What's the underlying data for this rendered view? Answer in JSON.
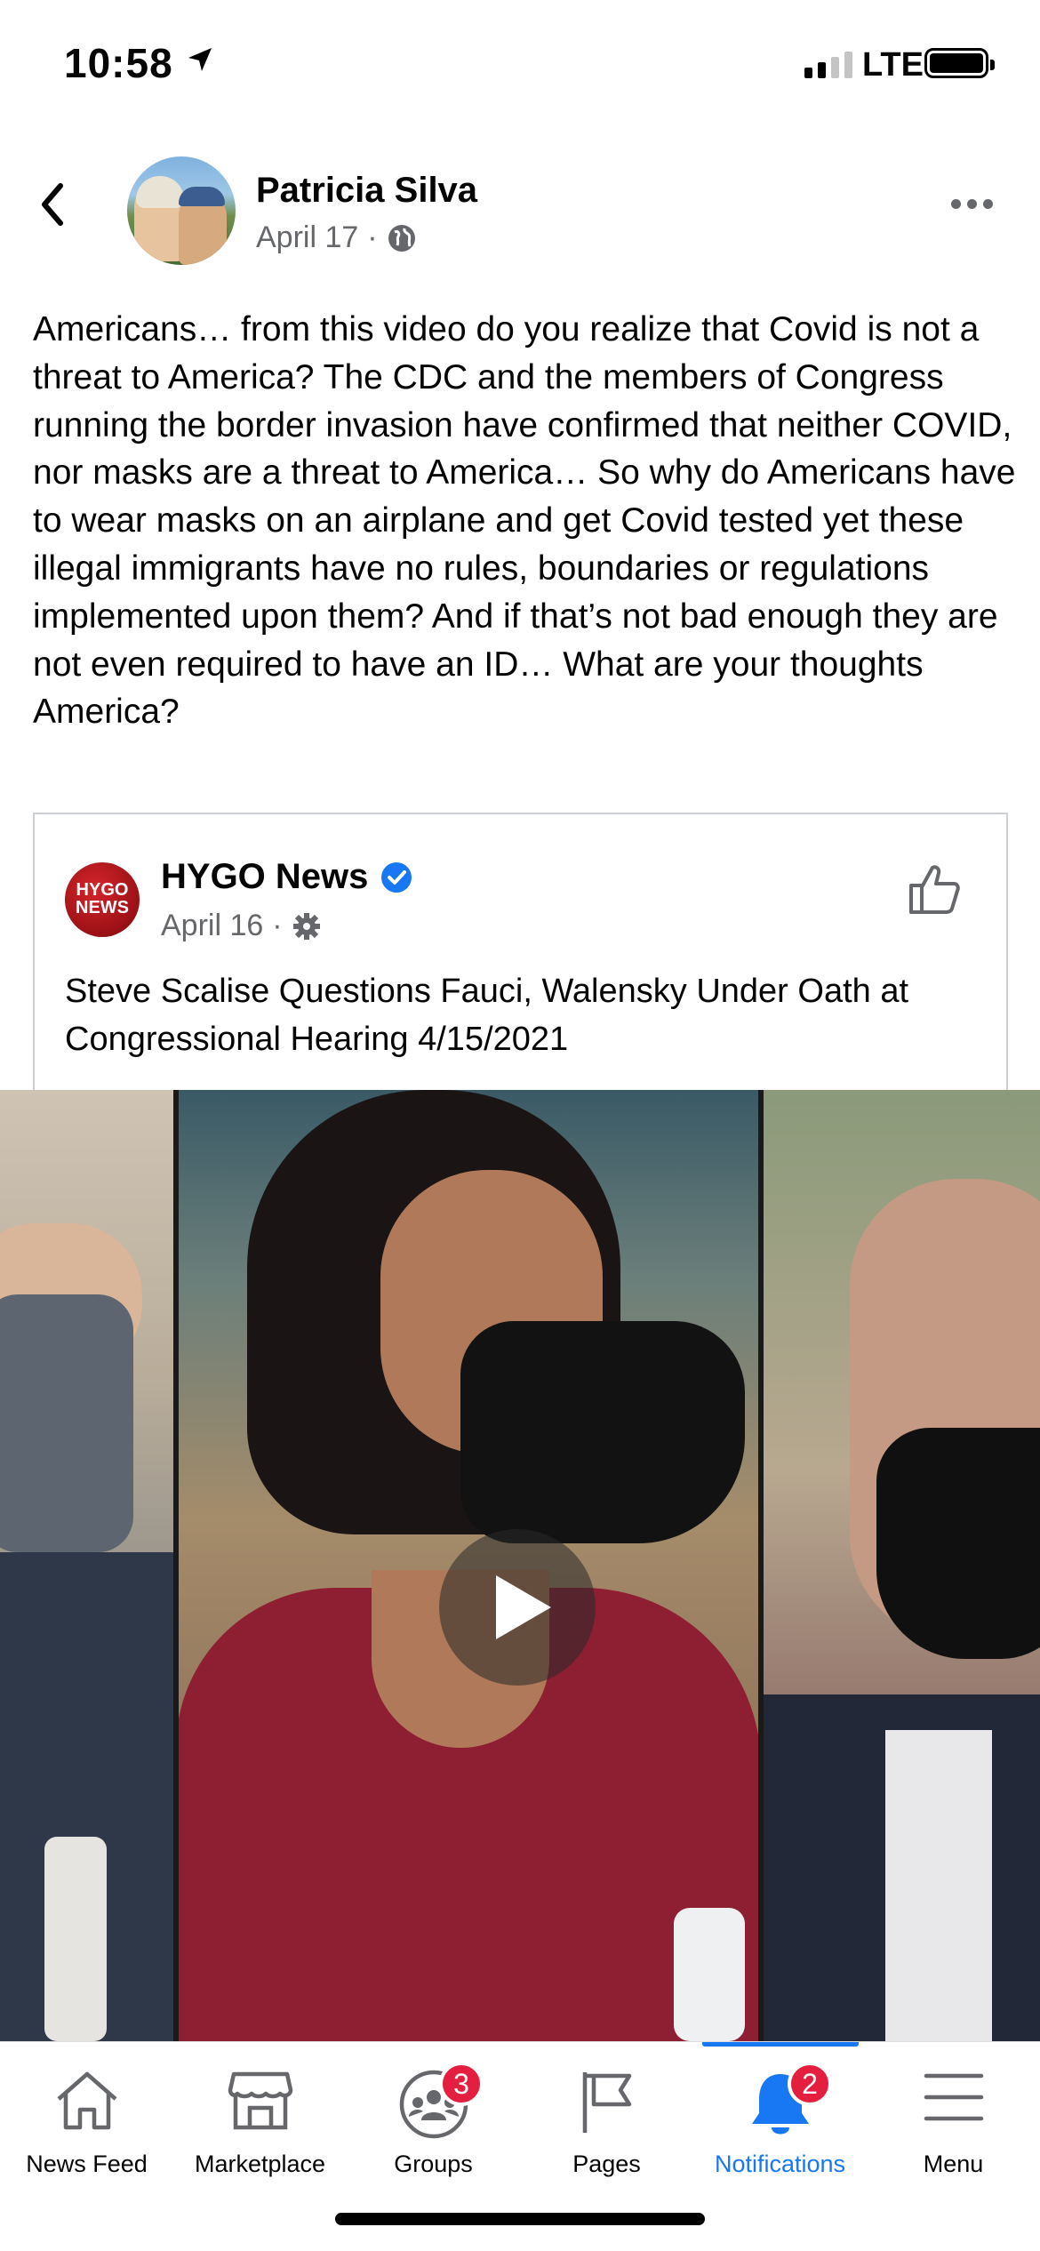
{
  "status_bar": {
    "time": "10:58",
    "network": "LTE"
  },
  "post": {
    "author": "Patricia Silva",
    "date": "April 17",
    "separator": "·",
    "text": "Americans… from this video do you realize that Covid is not a threat to America? The CDC and the members of Congress running the border invasion have confirmed that neither COVID, nor masks are a threat to America… So why do Americans have to wear masks on an airplane and get Covid tested yet these illegal immigrants have no rules, boundaries or regulations implemented upon them? And if that’s not bad enough they are not even required to have an ID… What are your thoughts America?"
  },
  "shared": {
    "logo_text": "HYGO NEWS",
    "page_name": "HYGO News",
    "date": "April 16",
    "separator": "·",
    "title": "Steve Scalise Questions Fauci, Walensky Under Oath at Congressional Hearing 4/15/2021"
  },
  "tabs": [
    {
      "label": "News Feed",
      "icon": "home-icon"
    },
    {
      "label": "Marketplace",
      "icon": "marketplace-icon"
    },
    {
      "label": "Groups",
      "icon": "groups-icon",
      "badge": "3"
    },
    {
      "label": "Pages",
      "icon": "flag-icon"
    },
    {
      "label": "Notifications",
      "icon": "bell-icon",
      "badge": "2",
      "active": true
    },
    {
      "label": "Menu",
      "icon": "menu-icon"
    }
  ],
  "colors": {
    "accent": "#1877f2",
    "badge": "#e41e3f",
    "secondary_text": "#65676b",
    "verified": "#1877f2"
  }
}
